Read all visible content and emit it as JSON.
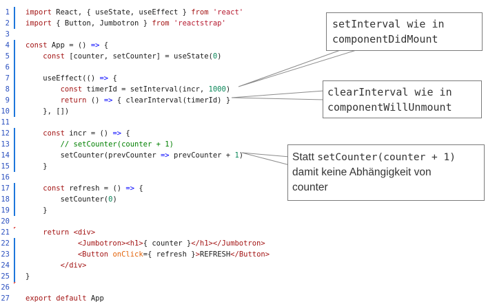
{
  "code_lines": [
    {
      "n": "1",
      "bar": true,
      "parts": [
        {
          "t": "import",
          "c": "kw"
        },
        {
          "t": " React, { useState, useEffect } "
        },
        {
          "t": "from",
          "c": "kw"
        },
        {
          "t": " "
        },
        {
          "t": "'react'",
          "c": "str"
        }
      ]
    },
    {
      "n": "2",
      "bar": true,
      "parts": [
        {
          "t": "import",
          "c": "kw"
        },
        {
          "t": " { Button, Jumbotron } "
        },
        {
          "t": "from",
          "c": "kw"
        },
        {
          "t": " "
        },
        {
          "t": "'reactstrap'",
          "c": "str"
        }
      ]
    },
    {
      "n": "3",
      "bar": false,
      "parts": []
    },
    {
      "n": "4",
      "bar": true,
      "parts": [
        {
          "t": "const",
          "c": "kw"
        },
        {
          "t": " App = () "
        },
        {
          "t": "=>",
          "c": "kw2"
        },
        {
          "t": " {"
        }
      ]
    },
    {
      "n": "5",
      "bar": true,
      "parts": [
        {
          "t": "    "
        },
        {
          "t": "const",
          "c": "kw"
        },
        {
          "t": " [counter, setCounter] = useState("
        },
        {
          "t": "0",
          "c": "num"
        },
        {
          "t": ")"
        }
      ]
    },
    {
      "n": "6",
      "bar": true,
      "parts": []
    },
    {
      "n": "7",
      "bar": true,
      "parts": [
        {
          "t": "    useEffect(() "
        },
        {
          "t": "=>",
          "c": "kw2"
        },
        {
          "t": " {"
        }
      ]
    },
    {
      "n": "8",
      "bar": true,
      "parts": [
        {
          "t": "        "
        },
        {
          "t": "const",
          "c": "kw"
        },
        {
          "t": " timerId = setInterval(incr, "
        },
        {
          "t": "1000",
          "c": "num"
        },
        {
          "t": ")"
        }
      ]
    },
    {
      "n": "9",
      "bar": true,
      "parts": [
        {
          "t": "        "
        },
        {
          "t": "return",
          "c": "kw"
        },
        {
          "t": " () "
        },
        {
          "t": "=>",
          "c": "kw2"
        },
        {
          "t": " { clearInterval(timerId) }"
        }
      ]
    },
    {
      "n": "10",
      "bar": true,
      "parts": [
        {
          "t": "    }, [])"
        }
      ]
    },
    {
      "n": "11",
      "bar": false,
      "parts": []
    },
    {
      "n": "12",
      "bar": true,
      "parts": [
        {
          "t": "    "
        },
        {
          "t": "const",
          "c": "kw"
        },
        {
          "t": " incr = () "
        },
        {
          "t": "=>",
          "c": "kw2"
        },
        {
          "t": " {"
        }
      ]
    },
    {
      "n": "13",
      "bar": true,
      "parts": [
        {
          "t": "        "
        },
        {
          "t": "// setCounter(counter + 1)",
          "c": "cm"
        }
      ]
    },
    {
      "n": "14",
      "bar": true,
      "parts": [
        {
          "t": "        setCounter(prevCounter "
        },
        {
          "t": "=>",
          "c": "kw2"
        },
        {
          "t": " prevCounter + "
        },
        {
          "t": "1",
          "c": "num"
        },
        {
          "t": ")"
        }
      ]
    },
    {
      "n": "15",
      "bar": true,
      "parts": [
        {
          "t": "    }"
        }
      ]
    },
    {
      "n": "16",
      "bar": false,
      "parts": []
    },
    {
      "n": "17",
      "bar": true,
      "parts": [
        {
          "t": "    "
        },
        {
          "t": "const",
          "c": "kw"
        },
        {
          "t": " refresh = () "
        },
        {
          "t": "=>",
          "c": "kw2"
        },
        {
          "t": " {"
        }
      ]
    },
    {
      "n": "18",
      "bar": true,
      "parts": [
        {
          "t": "        setCounter("
        },
        {
          "t": "0",
          "c": "num"
        },
        {
          "t": ")"
        }
      ]
    },
    {
      "n": "19",
      "bar": true,
      "parts": [
        {
          "t": "    }"
        }
      ]
    },
    {
      "n": "20",
      "bar": false,
      "parts": []
    },
    {
      "n": "21",
      "bar": false,
      "mark": true,
      "parts": [
        {
          "t": "    "
        },
        {
          "t": "return",
          "c": "kw"
        },
        {
          "t": " "
        },
        {
          "t": "<div>",
          "c": "tag"
        }
      ]
    },
    {
      "n": "22",
      "bar": true,
      "parts": [
        {
          "t": "            "
        },
        {
          "t": "<Jumbotron><h1>",
          "c": "tag"
        },
        {
          "t": "{ counter }"
        },
        {
          "t": "</h1></Jumbotron>",
          "c": "tag"
        }
      ]
    },
    {
      "n": "23",
      "bar": true,
      "parts": [
        {
          "t": "            "
        },
        {
          "t": "<Button",
          "c": "tag"
        },
        {
          "t": " "
        },
        {
          "t": "onClick",
          "c": "attr"
        },
        {
          "t": "={ refresh }"
        },
        {
          "t": ">",
          "c": "tag"
        },
        {
          "t": "REFRESH"
        },
        {
          "t": "</Button>",
          "c": "tag"
        }
      ]
    },
    {
      "n": "24",
      "bar": true,
      "parts": [
        {
          "t": "        "
        },
        {
          "t": "</div>",
          "c": "tag"
        }
      ]
    },
    {
      "n": "25",
      "bar": true,
      "parts": [
        {
          "t": "}"
        }
      ]
    },
    {
      "n": "26",
      "bar": false,
      "mark": true,
      "parts": []
    },
    {
      "n": "27",
      "bar": false,
      "parts": [
        {
          "t": "export",
          "c": "kw"
        },
        {
          "t": " "
        },
        {
          "t": "default",
          "c": "kw"
        },
        {
          "t": " App"
        }
      ]
    }
  ],
  "callouts": {
    "set_interval": {
      "mono": "setInterval",
      "rest": " wie in",
      "line2": "componentDidMount"
    },
    "clear_interval": {
      "mono": "clearInterval",
      "rest": " wie in",
      "line2": "componentWillUnmount"
    },
    "statt": {
      "pre": "Statt ",
      "mono": "setCounter(counter + 1)",
      "line2": "damit keine Abhängigkeit von",
      "line3": "counter"
    }
  },
  "colors": {
    "keyword": "#a31515",
    "arrow": "#0000ff",
    "string": "#b5182e",
    "number": "#098658",
    "comment": "#008000",
    "line_number": "#2a4fbf",
    "gutter_bar": "#1d76db",
    "callout_border": "#7a7a7a"
  }
}
